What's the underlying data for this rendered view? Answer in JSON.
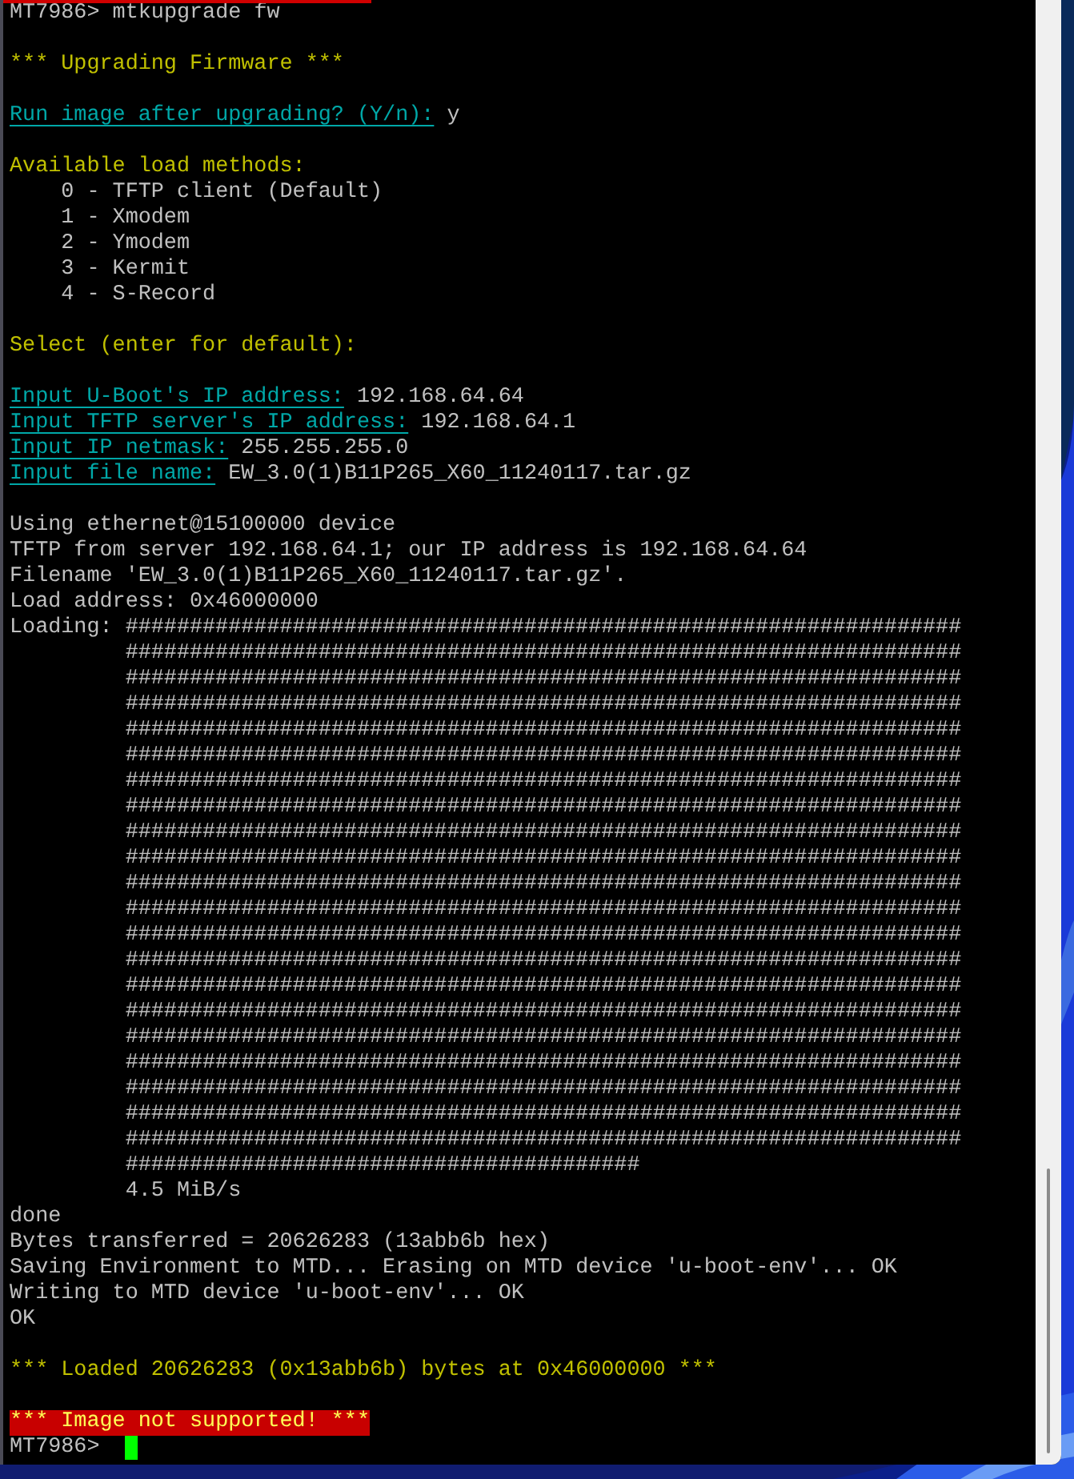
{
  "terminal": {
    "lines": [
      {
        "kind": "command",
        "prompt": "MT7986>",
        "text": "mtkupgrade fw"
      },
      {
        "kind": "blank"
      },
      {
        "kind": "notice",
        "text": "*** Upgrading Firmware ***"
      },
      {
        "kind": "blank"
      },
      {
        "kind": "question",
        "label": "Run image after upgrading? (Y/n):",
        "value": "y"
      },
      {
        "kind": "blank"
      },
      {
        "kind": "notice",
        "text": "Available load methods:"
      },
      {
        "kind": "option",
        "text": "0 - TFTP client (Default)"
      },
      {
        "kind": "option",
        "text": "1 - Xmodem"
      },
      {
        "kind": "option",
        "text": "2 - Ymodem"
      },
      {
        "kind": "option",
        "text": "3 - Kermit"
      },
      {
        "kind": "option",
        "text": "4 - S-Record"
      },
      {
        "kind": "blank"
      },
      {
        "kind": "notice",
        "text": "Select (enter for default):"
      },
      {
        "kind": "blank"
      },
      {
        "kind": "question",
        "label": "Input U-Boot's IP address:",
        "value": "192.168.64.64"
      },
      {
        "kind": "question",
        "label": "Input TFTP server's IP address:",
        "value": "192.168.64.1"
      },
      {
        "kind": "question",
        "label": "Input IP netmask:",
        "value": "255.255.255.0"
      },
      {
        "kind": "question",
        "label": "Input file name:",
        "value": "EW_3.0(1)B11P265_X60_11240117.tar.gz"
      },
      {
        "kind": "blank"
      },
      {
        "kind": "output",
        "text": "Using ethernet@15100000 device"
      },
      {
        "kind": "output",
        "text": "TFTP from server 192.168.64.1; our IP address is 192.168.64.64"
      },
      {
        "kind": "output",
        "text": "Filename 'EW_3.0(1)B11P265_X60_11240117.tar.gz'."
      },
      {
        "kind": "output",
        "text": "Load address: 0x46000000"
      },
      {
        "kind": "progress",
        "label": "Loading:",
        "rows": [
          "#################################################################",
          "#################################################################",
          "#################################################################",
          "#################################################################",
          "#################################################################",
          "#################################################################",
          "#################################################################",
          "#################################################################",
          "#################################################################",
          "#################################################################",
          "#################################################################",
          "#################################################################",
          "#################################################################",
          "#################################################################",
          "#################################################################",
          "#################################################################",
          "#################################################################",
          "#################################################################",
          "#################################################################",
          "#################################################################",
          "#################################################################",
          "########################################"
        ]
      },
      {
        "kind": "indented",
        "text": "4.5 MiB/s"
      },
      {
        "kind": "output",
        "text": "done"
      },
      {
        "kind": "output",
        "text": "Bytes transferred = 20626283 (13abb6b hex)"
      },
      {
        "kind": "output",
        "text": "Saving Environment to MTD... Erasing on MTD device 'u-boot-env'... OK"
      },
      {
        "kind": "output",
        "text": "Writing to MTD device 'u-boot-env'... OK"
      },
      {
        "kind": "output",
        "text": "OK"
      },
      {
        "kind": "blank"
      },
      {
        "kind": "notice",
        "text": "*** Loaded 20626283 (0x13abb6b) bytes at 0x46000000 ***"
      },
      {
        "kind": "blank"
      },
      {
        "kind": "error",
        "text": "*** Image not supported! ***"
      },
      {
        "kind": "command",
        "prompt": "MT7986>",
        "cursor": true
      }
    ]
  }
}
